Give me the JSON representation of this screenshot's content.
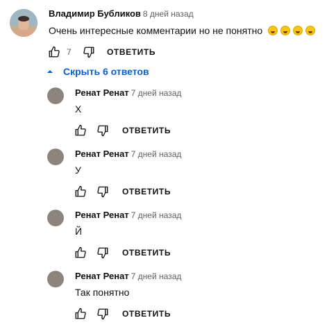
{
  "main_comment": {
    "author": "Владимир Бубликов",
    "time": "8 дней назад",
    "text": "Очень интересные комментарии но не понятно",
    "emoji_count": 4,
    "likes": "7",
    "reply_label": "ОТВЕТИТЬ"
  },
  "replies_toggle": {
    "label": "Скрыть 6 ответов",
    "icon": "caret-up-icon",
    "color": "#065fd4"
  },
  "replies": [
    {
      "author": "Ренат Ренат",
      "time": "7 дней назад",
      "text": "Х",
      "reply_label": "ОТВЕТИТЬ"
    },
    {
      "author": "Ренат Ренат",
      "time": "7 дней назад",
      "text": "У",
      "reply_label": "ОТВЕТИТЬ"
    },
    {
      "author": "Ренат Ренат",
      "time": "7 дней назад",
      "text": "Й",
      "reply_label": "ОТВЕТИТЬ"
    },
    {
      "author": "Ренат Ренат",
      "time": "7 дней назад",
      "text": "Так понятно",
      "reply_label": "ОТВЕТИТЬ"
    }
  ]
}
